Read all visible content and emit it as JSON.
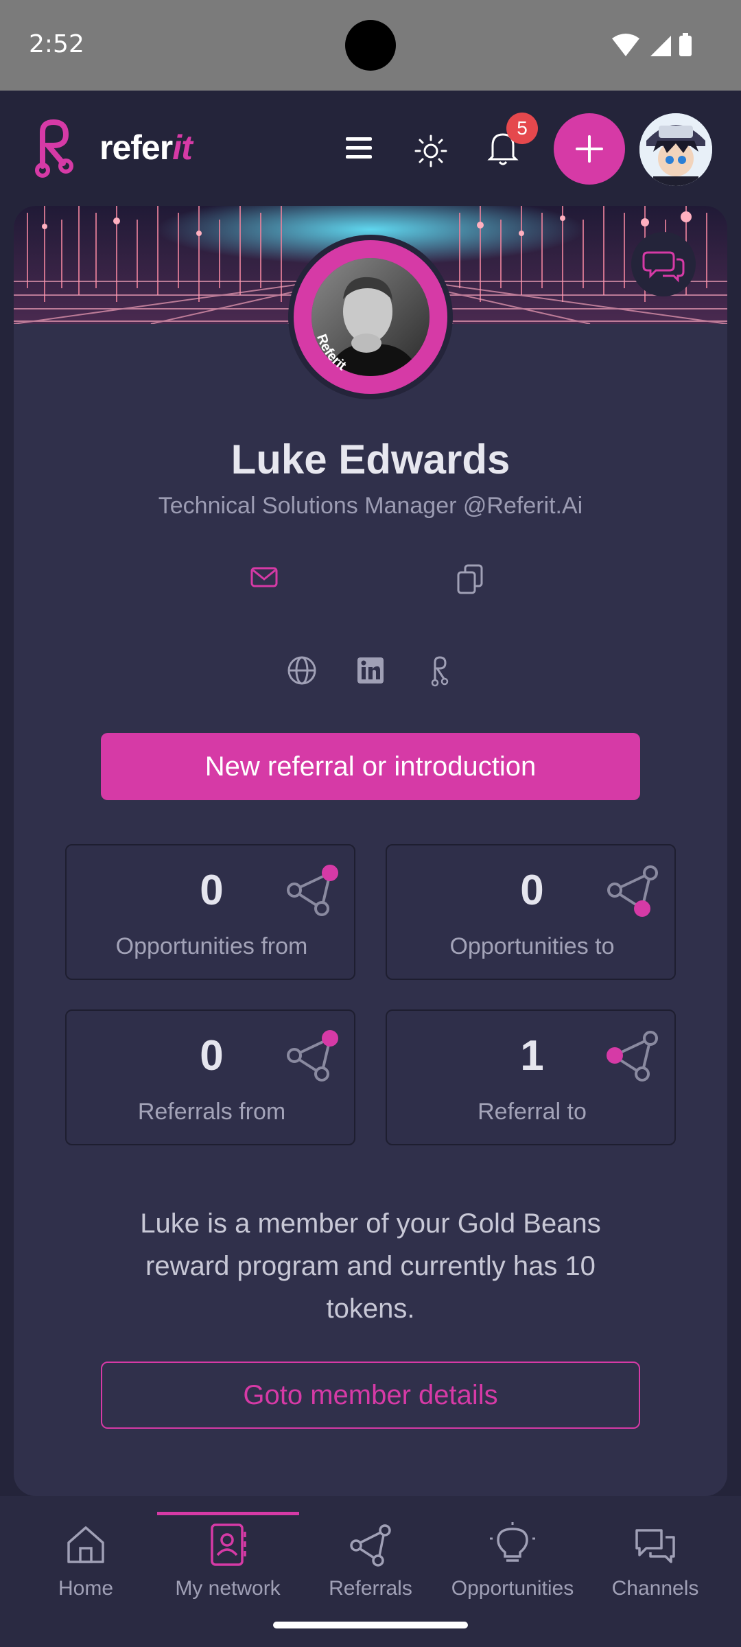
{
  "status_bar": {
    "time": "2:52"
  },
  "header": {
    "brand_main": "refer",
    "brand_accent": "it",
    "notification_count": "5",
    "icons": [
      "menu-icon",
      "sun-icon",
      "bell-icon",
      "plus-icon"
    ]
  },
  "profile": {
    "name": "Luke Edwards",
    "title": "Technical Solutions Manager @Referit.Ai",
    "photo_tag": "Referit",
    "contact_icons": [
      "mail-icon",
      "copy-icon"
    ],
    "link_icons": [
      "globe-icon",
      "linkedin-icon",
      "referit-icon"
    ]
  },
  "cta_label": "New referral or introduction",
  "stats": [
    {
      "value": "0",
      "label": "Opportunities from"
    },
    {
      "value": "0",
      "label": "Opportunities to"
    },
    {
      "value": "0",
      "label": "Referrals from"
    },
    {
      "value": "1",
      "label": "Referral to"
    }
  ],
  "gold_text": "Luke is a member of your Gold Beans reward program and currently has 10 tokens.",
  "goto_label": "Goto member details",
  "nav": [
    {
      "label": "Home",
      "active": false
    },
    {
      "label": "My network",
      "active": true
    },
    {
      "label": "Referrals",
      "active": false
    },
    {
      "label": "Opportunities",
      "active": false
    },
    {
      "label": "Channels",
      "active": false
    }
  ],
  "colors": {
    "accent": "#d63aa6",
    "background": "#24243a",
    "card": "#30304b"
  }
}
